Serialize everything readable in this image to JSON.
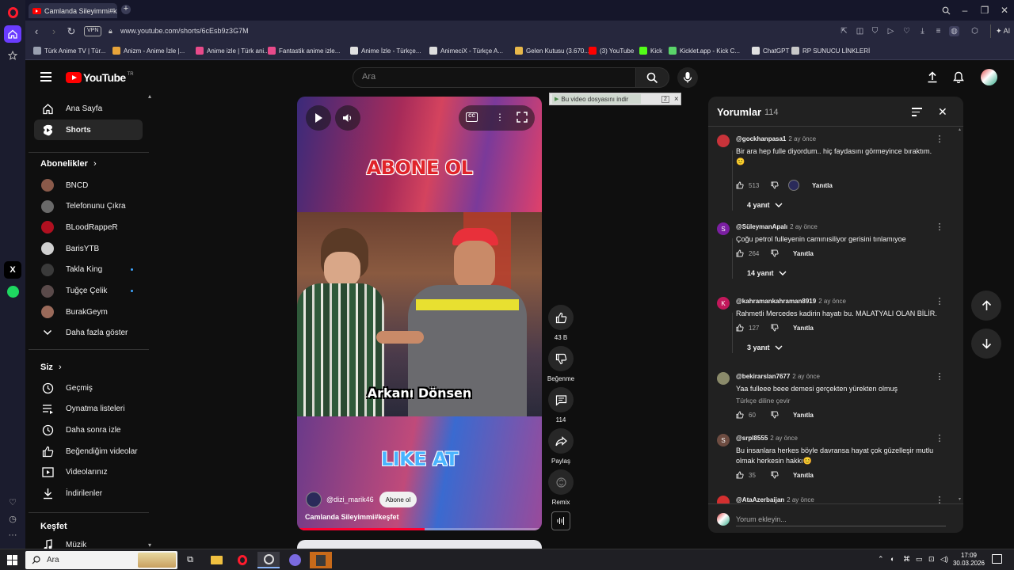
{
  "browser": {
    "tab_title": "Camlanda Sileyimmi#keşfet",
    "url": "www.youtube.com/shorts/6cEsb9z3G7M",
    "vpn_label": "VPN",
    "ai_label": "AI",
    "bookmarks": [
      {
        "label": "Türk Anime TV | Tür...",
        "color": "#9aa0b0"
      },
      {
        "label": "Anizm - Anime İzle |...",
        "color": "#e8a43a"
      },
      {
        "label": "Anime izle | Türk ani...",
        "color": "#e84a8a"
      },
      {
        "label": "Fantastik anime izle...",
        "color": "#e84a8a"
      },
      {
        "label": "Anime İzle - Türkçe...",
        "color": "#e0e0e0"
      },
      {
        "label": "AnimeciX - Türkçe A...",
        "color": "#dddddd"
      },
      {
        "label": "Gelen Kutusu (3.670...",
        "color": "#e8b84a"
      },
      {
        "label": "(3) YouTube",
        "color": "#ff0000"
      },
      {
        "label": "Kick",
        "color": "#53fc18"
      },
      {
        "label": "Kicklet.app - Kick C...",
        "color": "#5ad46a"
      },
      {
        "label": "ChatGPT",
        "color": "#e0e0e0"
      },
      {
        "label": "RP SUNUCU LİNKLERİ",
        "color": "#c8c8c8"
      }
    ]
  },
  "youtube": {
    "logo_text": "YouTube",
    "logo_region": "TR",
    "search_placeholder": "Ara"
  },
  "guide": {
    "main": [
      {
        "label": "Ana Sayfa",
        "icon": "home-icon"
      },
      {
        "label": "Shorts",
        "icon": "shorts-icon"
      }
    ],
    "subscriptions_header": "Abonelikler",
    "subscriptions": [
      {
        "label": "BNCD",
        "color": "#8a5a4a",
        "live": false
      },
      {
        "label": "Telefonunu Çıkra",
        "color": "#6a6a6a",
        "live": false
      },
      {
        "label": "BLoodRappeR",
        "color": "#b01020",
        "live": false
      },
      {
        "label": "BarisYTB",
        "color": "#d0d0d0",
        "live": false
      },
      {
        "label": "Takla King",
        "color": "#3a3a3a",
        "live": true
      },
      {
        "label": "Tuğçe Çelik",
        "color": "#5a4a4a",
        "live": true
      },
      {
        "label": "BurakGeym",
        "color": "#9a6a5a",
        "live": false
      }
    ],
    "show_more": "Daha fazla göster",
    "you_header": "Siz",
    "you_items": [
      {
        "label": "Geçmiş",
        "icon": "history-icon"
      },
      {
        "label": "Oynatma listeleri",
        "icon": "playlist-icon"
      },
      {
        "label": "Daha sonra izle",
        "icon": "watch-later-icon"
      },
      {
        "label": "Beğendiğim videolar",
        "icon": "like-icon"
      },
      {
        "label": "Videolarınız",
        "icon": "your-videos-icon"
      },
      {
        "label": "İndirilenler",
        "icon": "download-icon"
      }
    ],
    "explore_header": "Keşfet",
    "explore_items": [
      {
        "label": "Müzik",
        "icon": "music-icon"
      }
    ]
  },
  "short": {
    "overlay_top": "ABONE OL",
    "subtitle": "Arkanı Dönsen",
    "overlay_bottom": "LIKE AT",
    "channel": "@dizi_marik46",
    "subscribe_label": "Abone ol",
    "title": "Camlanda Sileyimmi#keşfet",
    "progress": 0.52
  },
  "actions": {
    "likes": "43 B",
    "dislike_label": "Beğenme",
    "comments_count": "114",
    "share_label": "Paylaş",
    "remix_label": "Remix"
  },
  "download_popup": {
    "label": "Bu video dosyasını indir",
    "count": "2",
    "close": "×"
  },
  "comments": {
    "title": "Yorumlar",
    "count": "114",
    "add_placeholder": "Yorum ekleyin...",
    "reply_label": "Yanıtla",
    "translate_label": "Türkçe diline çevir",
    "items": [
      {
        "author": "@gockhanpasa1",
        "time": "2 ay önce",
        "text": "Bir ara hep fulle diyordum.. hiç faydasını görmeyince bıraktım. 🙂",
        "likes": "513",
        "replies": "4 yanıt",
        "avatar_letter": "",
        "avatar_color": "#c8333a"
      },
      {
        "author": "@SüleymanApalı",
        "time": "2 ay önce",
        "text": "Çoğu petrol fulleyenin camınısiliyor gerisini tınlamıyoe",
        "likes": "264",
        "replies": "14 yanıt",
        "avatar_letter": "S",
        "avatar_color": "#7b1fa2"
      },
      {
        "author": "@kahramankahraman8919",
        "time": "2 ay önce",
        "text": "Rahmetli Mercedes kadirin hayatı bu. MALATYALI OLAN BİLİR.",
        "likes": "127",
        "replies": "3 yanıt",
        "avatar_letter": "K",
        "avatar_color": "#c2185b"
      },
      {
        "author": "@bekirarslan7677",
        "time": "2 ay önce",
        "text": "Yaa fulleee beee demesi gerçekten yürekten olmuş",
        "likes": "60",
        "replies": "",
        "avatar_letter": "",
        "avatar_color": "#8a8a6a"
      },
      {
        "author": "@srpl8555",
        "time": "2 ay önce",
        "text": "Bu insanlara herkes böyle davransa hayat çok güzelleşir mutlu olmak herkesin  hakkı😊",
        "likes": "35",
        "replies": "",
        "avatar_letter": "S",
        "avatar_color": "#6d4c41"
      },
      {
        "author": "@AtaAzerbaijan",
        "time": "2 ay önce",
        "text": "",
        "likes": "",
        "replies": "",
        "avatar_letter": "",
        "avatar_color": "#d32f2f"
      }
    ]
  },
  "taskbar": {
    "search_placeholder": "Ara",
    "time": "17:09",
    "date": "30.03.2026"
  },
  "colors": {
    "accent_red": "#ff0000",
    "opera_red": "#ff1b2d",
    "link_blue": "#3ea6ff"
  }
}
